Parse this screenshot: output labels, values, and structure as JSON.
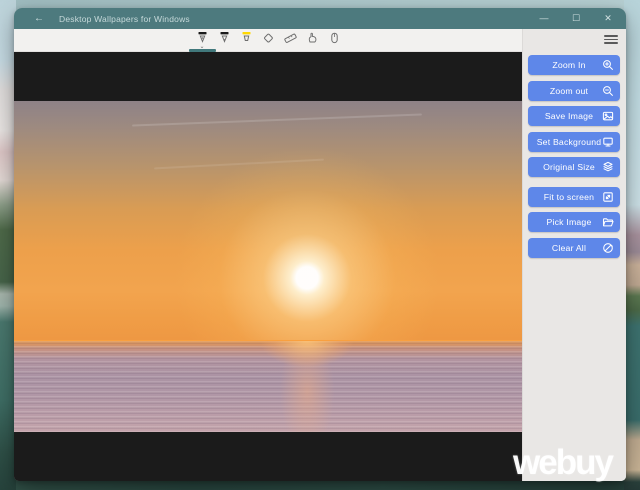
{
  "window": {
    "title": "Desktop Wallpapers for Windows",
    "back_glyph": "←",
    "controls": [
      {
        "name": "minimize",
        "glyph": "—"
      },
      {
        "name": "maximize",
        "glyph": "☐"
      },
      {
        "name": "close",
        "glyph": "✕"
      }
    ],
    "titlebar_color": "#4d7a7e"
  },
  "ink_toolbar": {
    "tools": [
      {
        "name": "ballpoint-pen",
        "tip_color": "#1a1a1a",
        "selected": true
      },
      {
        "name": "pencil",
        "tip_color": "#1a1a1a",
        "selected": false
      },
      {
        "name": "highlighter",
        "tip_color": "#ffd800",
        "selected": false
      },
      {
        "name": "eraser",
        "selected": false
      },
      {
        "name": "ruler",
        "selected": false
      },
      {
        "name": "touch-writing",
        "selected": false
      },
      {
        "name": "touch-input",
        "selected": false
      }
    ],
    "selection_color": "#41787b"
  },
  "sidebar": {
    "menu_icon": "hamburger-icon",
    "accent_color": "#5e87e9",
    "buttons": [
      {
        "label": "Zoom In",
        "icon": "zoom-in-icon",
        "extra_gap": false
      },
      {
        "label": "Zoom out",
        "icon": "zoom-out-icon",
        "extra_gap": false
      },
      {
        "label": "Save Image",
        "icon": "save-image-icon",
        "extra_gap": false
      },
      {
        "label": "Set Background",
        "icon": "set-background-icon",
        "extra_gap": false
      },
      {
        "label": "Original Size",
        "icon": "original-size-icon",
        "extra_gap": false
      },
      {
        "label": "Fit to screen",
        "icon": "fit-to-screen-icon",
        "extra_gap": true
      },
      {
        "label": "Pick Image",
        "icon": "pick-image-icon",
        "extra_gap": false
      },
      {
        "label": "Clear All",
        "icon": "clear-all-icon",
        "extra_gap": false
      }
    ]
  },
  "canvas": {
    "content": "sunset over sea photo",
    "letterbox_color": "#1b1b1b"
  },
  "watermark": {
    "text": "webuy"
  }
}
